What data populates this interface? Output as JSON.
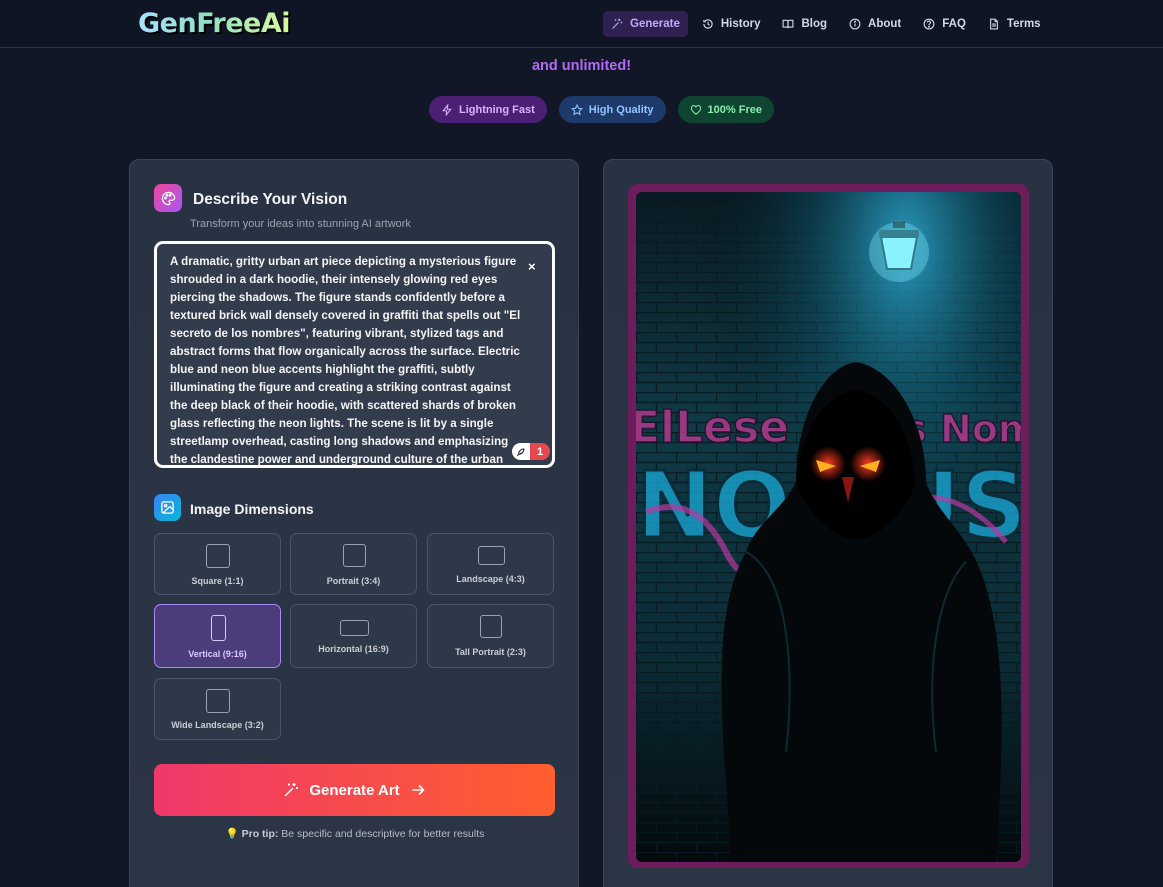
{
  "brand": {
    "logo": "GenFreeAi"
  },
  "nav": {
    "items": [
      {
        "label": "Generate",
        "icon": "magic-wand-icon",
        "active": true
      },
      {
        "label": "History",
        "icon": "history-icon"
      },
      {
        "label": "Blog",
        "icon": "book-icon"
      },
      {
        "label": "About",
        "icon": "info-icon"
      },
      {
        "label": "FAQ",
        "icon": "help-circle-icon"
      },
      {
        "label": "Terms",
        "icon": "document-icon"
      }
    ]
  },
  "hero": {
    "tail": "and unlimited!",
    "badges": [
      {
        "label": "Lightning Fast",
        "icon": "lightning-icon"
      },
      {
        "label": "High Quality",
        "icon": "star-icon"
      },
      {
        "label": "100% Free",
        "icon": "heart-icon"
      }
    ]
  },
  "vision": {
    "title": "Describe Your Vision",
    "subtitle": "Transform your ideas into stunning AI artwork",
    "prompt": "A dramatic, gritty urban art piece depicting a mysterious figure shrouded in a dark hoodie, their intensely glowing red eyes piercing the shadows. The figure stands confidently before a textured brick wall densely covered in graffiti that spells out \"El secreto de los nombres\", featuring vibrant, stylized tags and abstract forms that flow organically across the surface. Electric blue and neon blue accents highlight the graffiti, subtly illuminating the figure and creating a striking contrast against the deep black of their hoodie, with scattered shards of broken glass reflecting the neon lights. The scene is lit by a single streetlamp overhead, casting long shadows and emphasizing the clandestine power and underground culture of the urban setting.",
    "clear": "×",
    "counter": "1"
  },
  "dimensions": {
    "title": "Image Dimensions",
    "options": [
      {
        "label": "Square (1:1)",
        "ratio": "1:1",
        "selected": false
      },
      {
        "label": "Portrait (3:4)",
        "ratio": "3:4",
        "selected": false
      },
      {
        "label": "Landscape (4:3)",
        "ratio": "4:3",
        "selected": false
      },
      {
        "label": "Vertical (9:16)",
        "ratio": "9:16",
        "selected": true
      },
      {
        "label": "Horizontal (16:9)",
        "ratio": "16:9",
        "selected": false
      },
      {
        "label": "Tall Portrait (2:3)",
        "ratio": "2:3",
        "selected": false
      },
      {
        "label": "Wide Landscape (3:2)",
        "ratio": "3:2",
        "selected": false
      }
    ]
  },
  "generate": {
    "label": "Generate Art"
  },
  "tip": {
    "prefix": "Pro tip:",
    "text": " Be specific and descriptive for better results"
  },
  "colors": {
    "accent": "#a855f7",
    "cta_start": "#f0386b",
    "cta_end": "#ff5e2e",
    "frame": "#6e1d5c"
  }
}
